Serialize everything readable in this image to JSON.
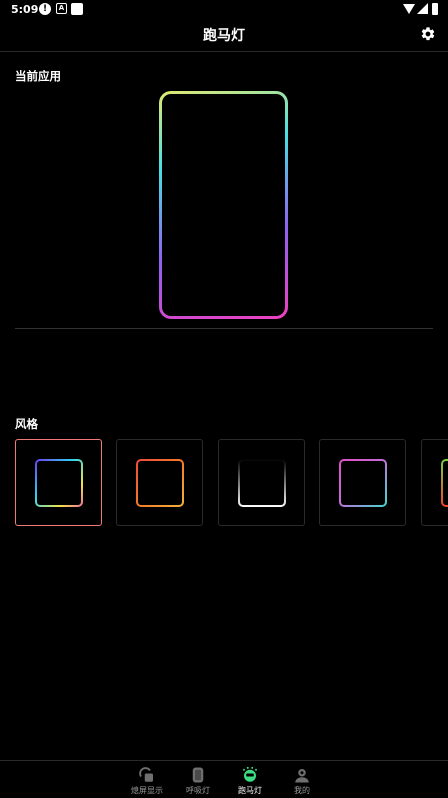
{
  "status_bar": {
    "time": "5:09",
    "icons": [
      "alert-circle-icon",
      "a-box-icon",
      "square-icon",
      "wifi-icon",
      "signal-icon",
      "battery-icon"
    ]
  },
  "app_bar": {
    "title": "跑马灯",
    "settings_icon": "gear-icon"
  },
  "current_app": {
    "label": "当前应用"
  },
  "styles": {
    "label": "风格",
    "selected_index": 0
  },
  "bottom_nav": {
    "items": [
      {
        "label": "熄屏显示",
        "icon": "aod-icon",
        "active": false
      },
      {
        "label": "呼吸灯",
        "icon": "breathing-light-icon",
        "active": false
      },
      {
        "label": "跑马灯",
        "icon": "marquee-icon",
        "active": true
      },
      {
        "label": "我的",
        "icon": "profile-icon",
        "active": false
      }
    ]
  },
  "colors": {
    "background": "#000000",
    "accent": "#3ddc84",
    "selected_border": "#f07a7a"
  }
}
